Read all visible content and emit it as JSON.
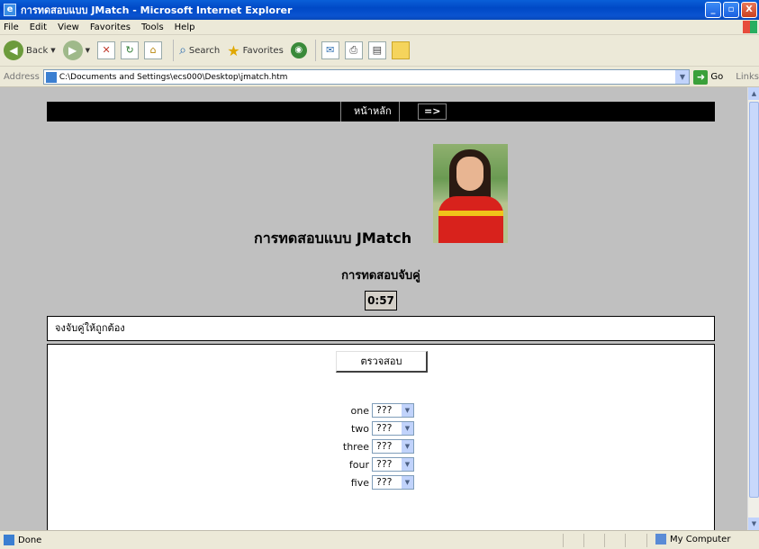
{
  "window": {
    "title": "การทดสอบแบบ JMatch - Microsoft Internet Explorer",
    "buttons": [
      "_",
      "▫",
      "X"
    ]
  },
  "menu": [
    "File",
    "Edit",
    "View",
    "Favorites",
    "Tools",
    "Help"
  ],
  "toolbar": {
    "back_label": "Back",
    "search_label": "Search",
    "favorites_label": "Favorites"
  },
  "address": {
    "label": "Address",
    "url": "C:\\Documents and Settings\\ecs000\\Desktop\\jmatch.htm",
    "go_label": "Go",
    "links_label": "Links"
  },
  "page": {
    "nav_home": "หน้าหลัก",
    "nav_next": "=>",
    "title": "การทดสอบแบบ JMatch",
    "subtitle": "การทดสอบจับคู่",
    "timer": "0:57",
    "instruction": "จงจับคู่ให้ถูกต้อง",
    "check_button": "ตรวจสอบ",
    "pairs": [
      {
        "label": "one",
        "selected": "???"
      },
      {
        "label": "two",
        "selected": "???"
      },
      {
        "label": "three",
        "selected": "???"
      },
      {
        "label": "four",
        "selected": "???"
      },
      {
        "label": "five",
        "selected": "???"
      }
    ]
  },
  "status": {
    "text": "Done",
    "zone": "My Computer"
  },
  "colors": {
    "page_background": "#c0c0c0",
    "nav_background": "#000000",
    "titlebar_blue": "#0a53d0"
  },
  "icons": [
    "ie-icon",
    "back-icon",
    "forward-icon",
    "stop-icon",
    "refresh-icon",
    "home-icon",
    "search-icon",
    "favorites-icon",
    "media-icon",
    "mail-icon",
    "print-icon",
    "edit-icon",
    "folder-icon",
    "go-icon",
    "page-icon",
    "computer-icon"
  ]
}
